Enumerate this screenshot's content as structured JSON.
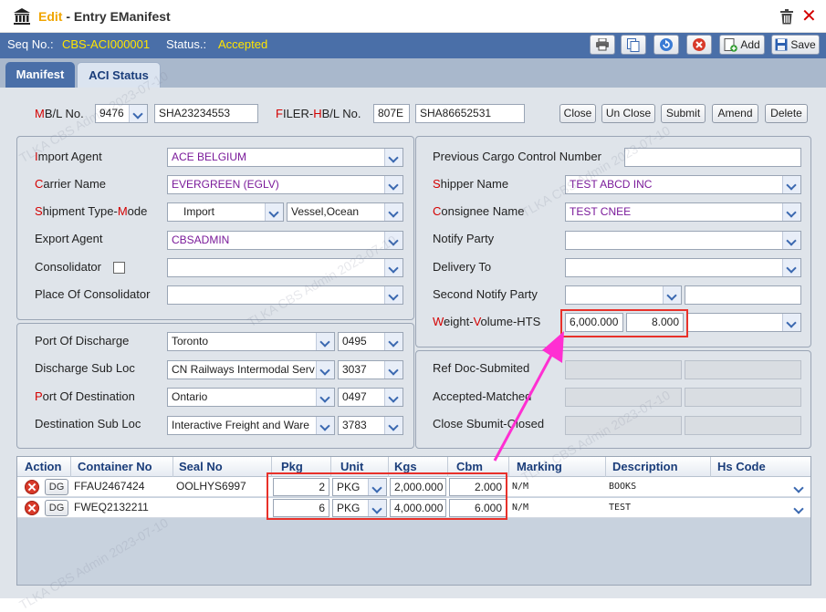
{
  "window": {
    "title_prefix": "Edit",
    "title": " - Entry EManifest"
  },
  "info": {
    "seq_label": "Seq No.:",
    "seq_value": "CBS-ACI000001",
    "status_label": "Status.:",
    "status_value": "Accepted"
  },
  "toolbar": {
    "add_label": "Add",
    "save_label": "Save"
  },
  "tabs": [
    {
      "label": "Manifest"
    },
    {
      "label": "ACI Status"
    }
  ],
  "header_row": {
    "mbl_label": "B/L No.",
    "mbl_first": "M",
    "mbl_select": "9476",
    "mbl_value": "SHA23234553",
    "filer_label_a": "ILER-",
    "filer_f": "F",
    "filer_h": "H",
    "filer_label_b": "B/L No.",
    "filer_code": "807E",
    "hbl_value": "SHA86652531",
    "buttons": [
      "Close",
      "Un Close",
      "Submit",
      "Amend",
      "Delete"
    ]
  },
  "left_panel": {
    "import_agent": {
      "first": "I",
      "rest": "mport Agent",
      "value": "ACE BELGIUM"
    },
    "carrier_name": {
      "first": "C",
      "rest": "arrier Name",
      "value": "EVERGREEN (EGLV)"
    },
    "shipment_type": {
      "first": "S",
      "mid": "hipment Type-",
      "m": "M",
      "rest": "ode",
      "type_value": "Import",
      "mode_value": "Vessel,Ocean"
    },
    "export_agent": {
      "label": "Export Agent",
      "value": "CBSADMIN"
    },
    "consolidator": {
      "label": "Consolidator",
      "value": ""
    },
    "place_of_consolidator": {
      "label": "Place Of Consolidator",
      "value": ""
    }
  },
  "port_panel": {
    "port_of_discharge": {
      "label": "Port Of Discharge",
      "value": "Toronto",
      "code": "0495"
    },
    "discharge_sub_loc": {
      "label": "Discharge Sub Loc",
      "value": "CN Railways Intermodal  Serv",
      "code": "3037"
    },
    "port_of_destination": {
      "first": "P",
      "rest": "ort Of Destination",
      "value": "Ontario",
      "code": "0497"
    },
    "destination_sub_loc": {
      "label": "Destination Sub Loc",
      "value": "Interactive Freight and  Ware",
      "code": "3783"
    }
  },
  "right_panel": {
    "prev_ccn": {
      "label": "Previous Cargo Control Number",
      "value": ""
    },
    "shipper_name": {
      "first": "S",
      "rest": "hipper Name",
      "value": "TEST ABCD INC"
    },
    "consignee_name": {
      "first": "C",
      "rest": "onsignee Name",
      "value": "TEST CNEE"
    },
    "notify_party": {
      "label": "Notify Party",
      "value": ""
    },
    "delivery_to": {
      "label": "Delivery To",
      "value": ""
    },
    "second_notify_party": {
      "label": "Second Notify Party",
      "value": ""
    },
    "weight_volume_hts": {
      "w": "W",
      "eight": "eight-",
      "v": "V",
      "olume": "olume-HTS",
      "weight": "6,000.000",
      "volume": "8.000",
      "hts": ""
    }
  },
  "ref_panel": {
    "ref_doc_submited": {
      "label": "Ref Doc-Submited"
    },
    "accepted_matched": {
      "label": "Accepted-Matched"
    },
    "close_sbumit_closed": {
      "label": "Close Sbumit-Closed"
    }
  },
  "grid": {
    "headers": [
      "Action",
      "Container No",
      "Seal No",
      "Pkg",
      "Unit",
      "Kgs",
      "Cbm",
      "Marking",
      "Description",
      "Hs Code"
    ],
    "dg_label": "DG",
    "rows": [
      {
        "container": "FFAU2467424",
        "seal": "OOLHYS6997",
        "pkg": "2",
        "unit": "PKG",
        "kgs": "2,000.000",
        "cbm": "2.000",
        "marking": "N/M",
        "description": "BOOKS",
        "hs": ""
      },
      {
        "container": "FWEQ2132211",
        "seal": "",
        "pkg": "6",
        "unit": "PKG",
        "kgs": "4,000.000",
        "cbm": "6.000",
        "marking": "N/M",
        "description": "TEST",
        "hs": ""
      }
    ]
  },
  "colors": {
    "header_bar": "#4a6fa8",
    "accent_yellow": "#ffe500",
    "required_red": "#d40000",
    "highlight_red": "#e8312a",
    "arrow_magenta": "#ff2fd2"
  },
  "watermark": "TLKA CBS Admin 2023-07-10"
}
